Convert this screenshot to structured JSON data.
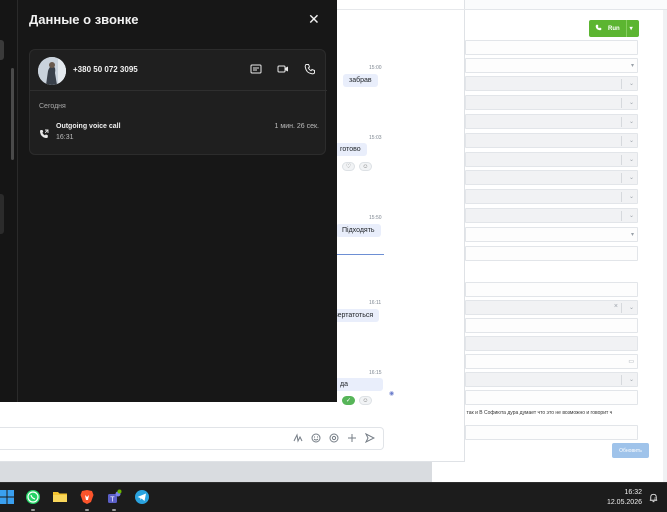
{
  "call_panel": {
    "title": "Данные о звонке",
    "close_glyph": "✕",
    "contact": {
      "phone": "+380 50 072 3095",
      "avatar": "avatar"
    },
    "actions": [
      "message-icon",
      "video-call-icon",
      "phone-icon"
    ],
    "section_label": "Сегодня",
    "call": {
      "type": "Outgoing voice call",
      "time": "16:31",
      "duration": "1 мин. 26 сек."
    }
  },
  "chat": {
    "messages": [
      {
        "time": "15:00",
        "text": "забрав"
      },
      {
        "time": "15:03",
        "text": "готово"
      },
      {
        "time": "15:50",
        "text": "Підходять"
      },
      {
        "time": "16:11",
        "text": "вертатоться"
      },
      {
        "time": "16:15",
        "text": "да"
      }
    ],
    "composer_tools": [
      "signature-icon",
      "emoji-icon",
      "sticker-icon",
      "attach-plus-icon",
      "send-icon"
    ]
  },
  "crm": {
    "run_label": "Run",
    "note_text": "ИСК так и В Софиюта дура думает что это не возможно и говорит ч",
    "update_label": "Обновить",
    "accent_color": "#5cb531"
  },
  "taskbar": {
    "apps": [
      "windows-start-icon",
      "whatsapp-icon",
      "file-explorer-icon",
      "brave-browser-icon",
      "teams-icon",
      "telegram-icon"
    ],
    "time": "16:32",
    "date": "12.05.2026"
  }
}
